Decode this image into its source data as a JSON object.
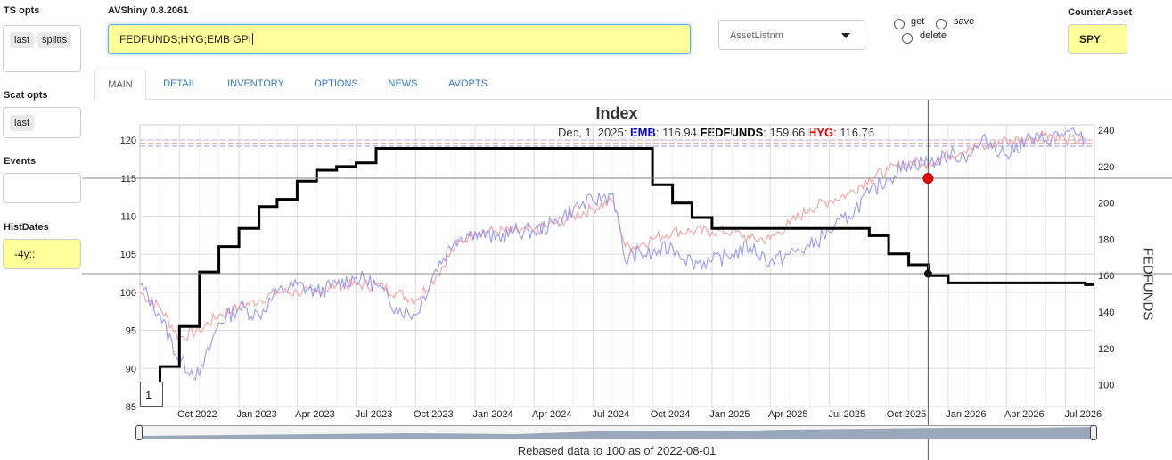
{
  "app": {
    "title": "AVShiny 0.8.2061"
  },
  "sidebar": {
    "ts_opts_label": "TS opts",
    "ts_opts_chips": [
      "last",
      "splitts"
    ],
    "scat_opts_label": "Scat opts",
    "scat_opts_chips": [
      "last"
    ],
    "events_label": "Events",
    "events_value": "",
    "histdates_label": "HistDates",
    "histdates_value": "-4y::"
  },
  "header": {
    "ticker_input": "FEDFUNDS;HYG;EMB GPI",
    "asset_select": "AssetListnm",
    "radios": {
      "get": "get",
      "save": "save",
      "delete": "delete"
    },
    "counter_asset_label": "CounterAsset",
    "counter_asset_value": "SPY"
  },
  "tabs": [
    {
      "label": "MAIN",
      "active": true
    },
    {
      "label": "DETAIL",
      "active": false
    },
    {
      "label": "INVENTORY",
      "active": false
    },
    {
      "label": "OPTIONS",
      "active": false
    },
    {
      "label": "NEWS",
      "active": false
    },
    {
      "label": "AVOPTS",
      "active": false
    }
  ],
  "chart": {
    "title": "Index",
    "legend": {
      "date": "Dec, 1, 2025:",
      "items": [
        {
          "name": "EMB",
          "value": ": 116.94",
          "color": "#0000cc"
        },
        {
          "name": "FEDFUNDS",
          "value": ": 159.66",
          "color": "#000000"
        },
        {
          "name": "HYG",
          "value": ": 116.76",
          "color": "#dd0000"
        }
      ]
    },
    "y2label": "FEDFUNDS",
    "footer": "Rebased data to 100 as of 2022-08-01",
    "range_marker": "1",
    "colors": {
      "emb": "#9999ee",
      "hyg": "#f0a0a0",
      "fedfunds": "#000000",
      "highlight": "#ee0000"
    }
  },
  "chart_data": {
    "type": "line",
    "y_ticks": [
      85,
      90,
      95,
      100,
      105,
      110,
      115,
      120
    ],
    "y2_ticks": [
      100,
      120,
      140,
      160,
      180,
      200,
      220,
      240
    ],
    "x_ticks": [
      "Oct 2022",
      "Jan 2023",
      "Apr 2023",
      "Jul 2023",
      "Oct 2023",
      "Jan 2024",
      "Apr 2024",
      "Jul 2024",
      "Oct 2024",
      "Jan 2025",
      "Apr 2025",
      "Jul 2025",
      "Oct 2025",
      "Jan 2026",
      "Apr 2026",
      "Jul 2026"
    ],
    "ylim": [
      85,
      122
    ],
    "y2lim": [
      88,
      243
    ],
    "series": [
      {
        "name": "FEDFUNDS",
        "axis": "right",
        "x": [
          "2022-08-01",
          "2022-09-01",
          "2022-10-01",
          "2022-11-01",
          "2022-12-01",
          "2023-01-01",
          "2023-02-01",
          "2023-03-01",
          "2023-04-01",
          "2023-05-01",
          "2023-06-01",
          "2023-07-01",
          "2023-08-01",
          "2024-09-01",
          "2024-10-01",
          "2024-11-01",
          "2024-12-01",
          "2025-01-01",
          "2025-08-01",
          "2025-09-01",
          "2025-10-01",
          "2025-11-01",
          "2025-12-01",
          "2026-01-01",
          "2026-05-01",
          "2026-08-01"
        ],
        "values": [
          100,
          110,
          132,
          162,
          176,
          186,
          198,
          202,
          212,
          218,
          220,
          222,
          230,
          230,
          210,
          200,
          192,
          186,
          186,
          182,
          172,
          166,
          160,
          156,
          156,
          155
        ]
      },
      {
        "name": "EMB",
        "axis": "left",
        "x": [
          "2022-08-01",
          "2022-09-01",
          "2022-10-01",
          "2022-11-01",
          "2022-12-01",
          "2023-01-01",
          "2023-02-01",
          "2023-03-01",
          "2023-04-01",
          "2023-05-01",
          "2023-06-01",
          "2023-07-01",
          "2023-08-01",
          "2023-09-01",
          "2023-10-01",
          "2023-11-01",
          "2023-12-01",
          "2024-01-01",
          "2024-02-01",
          "2024-03-01",
          "2024-04-01",
          "2024-05-01",
          "2024-06-01",
          "2024-07-01",
          "2024-08-01",
          "2024-08-20",
          "2024-09-01",
          "2024-10-01",
          "2024-11-01",
          "2024-12-01",
          "2025-01-01",
          "2025-02-01",
          "2025-03-01",
          "2025-04-01",
          "2025-05-01",
          "2025-06-01",
          "2025-07-01",
          "2025-08-01",
          "2025-09-01",
          "2025-10-01",
          "2025-11-01",
          "2025-12-01",
          "2026-01-01",
          "2026-02-01",
          "2026-03-01",
          "2026-04-01",
          "2026-05-01",
          "2026-06-01",
          "2026-07-01",
          "2026-08-01"
        ],
        "values": [
          101,
          97,
          91,
          89,
          96,
          98,
          97,
          100,
          101,
          100,
          101,
          102,
          101,
          98,
          97,
          103,
          107,
          108,
          107,
          108,
          108,
          109,
          111,
          112,
          113,
          104,
          105,
          105,
          106,
          104,
          104,
          105,
          106,
          104,
          105,
          106,
          108,
          110,
          113,
          115,
          117,
          117,
          118,
          118,
          120,
          118,
          120,
          120,
          121,
          120
        ]
      },
      {
        "name": "HYG",
        "axis": "left",
        "x": [
          "2022-08-01",
          "2022-09-01",
          "2022-10-01",
          "2022-11-01",
          "2022-12-01",
          "2023-01-01",
          "2023-02-01",
          "2023-03-01",
          "2023-04-01",
          "2023-05-01",
          "2023-06-01",
          "2023-07-01",
          "2023-08-01",
          "2023-09-01",
          "2023-10-01",
          "2023-11-01",
          "2023-12-01",
          "2024-01-01",
          "2024-02-01",
          "2024-03-01",
          "2024-04-01",
          "2024-05-01",
          "2024-06-01",
          "2024-07-01",
          "2024-08-01",
          "2024-08-20",
          "2024-09-01",
          "2024-10-01",
          "2024-11-01",
          "2024-12-01",
          "2025-01-01",
          "2025-02-01",
          "2025-03-01",
          "2025-04-01",
          "2025-05-01",
          "2025-06-01",
          "2025-07-01",
          "2025-08-01",
          "2025-09-01",
          "2025-10-01",
          "2025-11-01",
          "2025-12-01",
          "2026-01-01",
          "2026-02-01",
          "2026-03-01",
          "2026-04-01",
          "2026-05-01",
          "2026-06-01",
          "2026-07-01",
          "2026-08-01"
        ],
        "values": [
          100,
          98,
          94,
          95,
          97,
          98,
          99,
          100,
          100,
          100,
          101,
          101,
          101,
          100,
          99,
          102,
          106,
          108,
          108,
          108,
          108,
          109,
          110,
          111,
          112,
          106,
          106,
          107,
          108,
          108,
          108,
          108,
          107,
          107,
          109,
          111,
          112,
          113,
          115,
          116,
          117,
          117,
          118,
          119,
          119,
          120,
          120,
          121,
          120,
          120
        ]
      }
    ],
    "highlight_date": "2025-12-01",
    "hlines_left": [
      119.6,
      120,
      119.2
    ],
    "grid": true,
    "legend_position": "top-center"
  }
}
